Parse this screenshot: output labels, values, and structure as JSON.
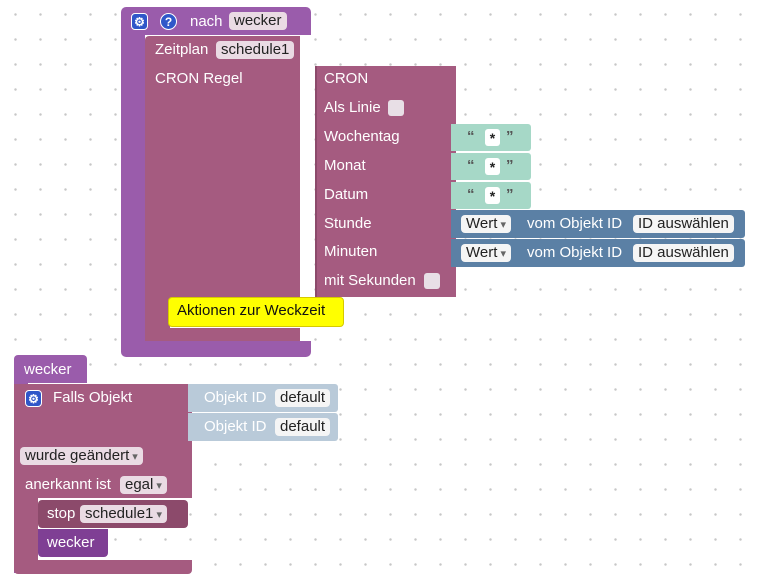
{
  "nach_block": {
    "nach_label": "nach",
    "name_value": "wecker"
  },
  "schedule_block": {
    "zeitplan_label": "Zeitplan",
    "schedule_value": "schedule1",
    "cron_rule_label": "CRON Regel",
    "actions_comment": "Aktionen zur Weckzeit"
  },
  "cron_block": {
    "title": "CRON",
    "als_linie_label": "Als Linie",
    "wochentag_label": "Wochentag",
    "monat_label": "Monat",
    "datum_label": "Datum",
    "stunde_label": "Stunde",
    "minuten_label": "Minuten",
    "mit_sekunden_label": "mit Sekunden",
    "wildcard_value": "*"
  },
  "value_blocks": {
    "wert_label": "Wert",
    "vom_objekt_label": "vom Objekt ID",
    "id_select_label": "ID auswählen"
  },
  "call_wecker_top": {
    "label": "wecker"
  },
  "trigger_block": {
    "falls_objekt_label": "Falls Objekt",
    "objekt_id_label": "Objekt ID",
    "default_value": "default",
    "wurde_geaendert_label": "wurde geändert",
    "anerkannt_ist_label": "anerkannt ist",
    "egal_value": "egal",
    "stop_label": "stop",
    "stop_value": "schedule1",
    "wecker_call_label": "wecker"
  },
  "colors": {
    "procedure": "#9a5cab",
    "schedule": "#a55b80",
    "text": "#a6d8c7",
    "objects": "#5b80a5",
    "comment": "#ffff00"
  },
  "icons": [
    "gear-icon",
    "help-icon"
  ]
}
